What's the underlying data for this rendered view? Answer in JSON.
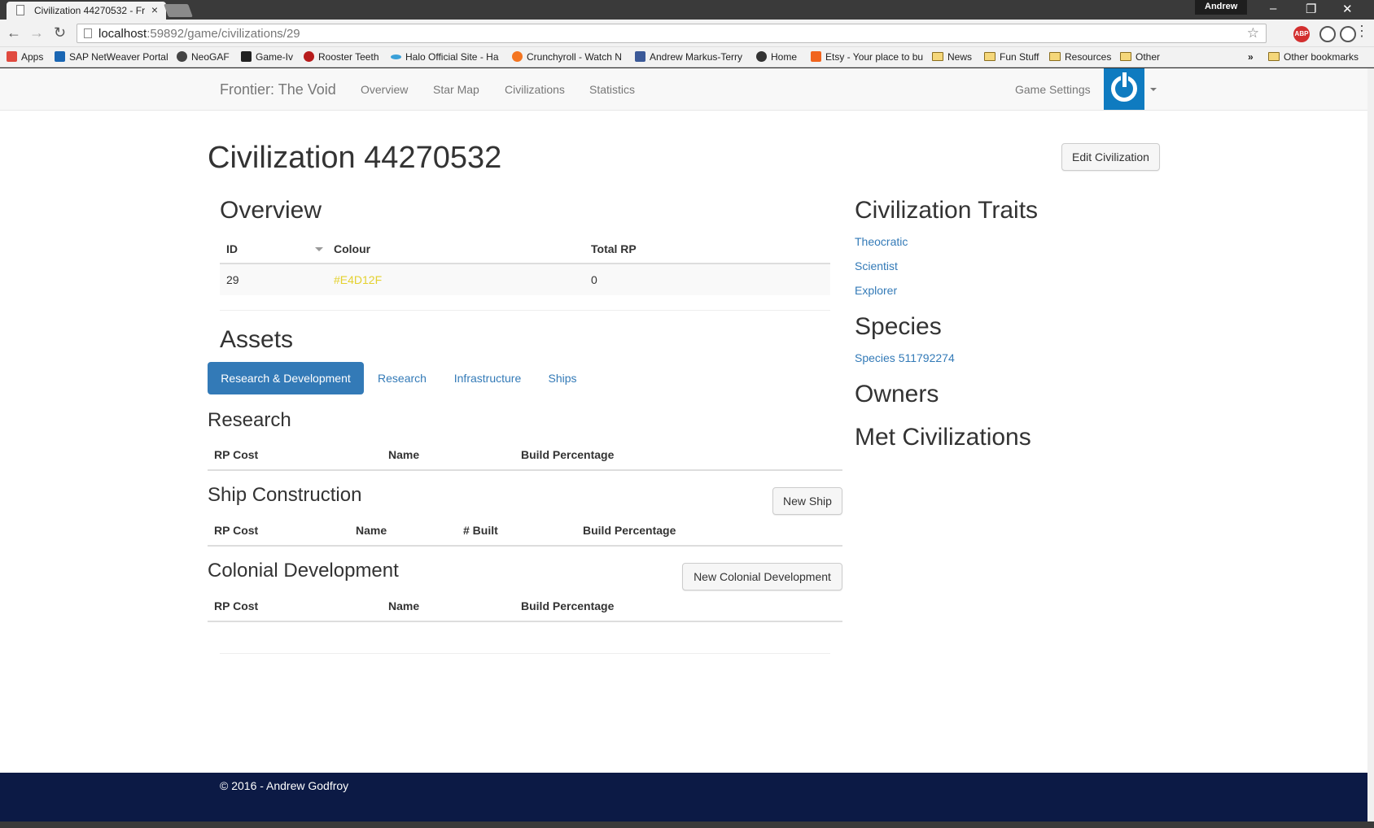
{
  "browser": {
    "tab_title": "Civilization 44270532 - Fr",
    "tab_close": "×",
    "user_badge": "Andrew",
    "url_host": "localhost",
    "url_rest": ":59892/game/civilizations/29",
    "minimize": "‒",
    "restore": "❐",
    "close": "✕",
    "ext_abp": "ABP",
    "bookmarks": [
      {
        "label": "Apps",
        "color": "#e04a3f"
      },
      {
        "label": "SAP NetWeaver Portal",
        "color": "#1a66b3"
      },
      {
        "label": "NeoGAF",
        "color": "#444444"
      },
      {
        "label": "Game-Iv",
        "color": "#222222"
      },
      {
        "label": "Rooster Teeth",
        "color": "#b71c1c"
      },
      {
        "label": "Halo Official Site - Ha",
        "color": "#3aa0d8"
      },
      {
        "label": "Crunchyroll - Watch N",
        "color": "#f47521"
      },
      {
        "label": "Andrew Markus-Terry",
        "color": "#3b5998"
      },
      {
        "label": "Home",
        "color": "#333333"
      },
      {
        "label": "Etsy - Your place to bu",
        "color": "#f1641e"
      }
    ],
    "folders": [
      "News",
      "Fun Stuff",
      "Resources",
      "Other"
    ],
    "overflow": "»",
    "other_bookmarks": "Other bookmarks"
  },
  "nav": {
    "brand": "Frontier: The Void",
    "links": [
      "Overview",
      "Star Map",
      "Civilizations",
      "Statistics"
    ],
    "game_settings": "Game Settings"
  },
  "page": {
    "title": "Civilization 44270532",
    "edit_button": "Edit Civilization"
  },
  "overview": {
    "heading": "Overview",
    "columns": [
      "ID",
      "Colour",
      "Total RP"
    ],
    "row": {
      "id": "29",
      "colour": "#E4D12F",
      "total_rp": "0"
    }
  },
  "assets": {
    "heading": "Assets",
    "tabs": [
      "Research & Development",
      "Research",
      "Infrastructure",
      "Ships"
    ],
    "active_tab": "Research & Development"
  },
  "research": {
    "heading": "Research",
    "columns": [
      "RP Cost",
      "Name",
      "Build Percentage"
    ]
  },
  "ships": {
    "heading": "Ship Construction",
    "button": "New Ship",
    "columns": [
      "RP Cost",
      "Name",
      "# Built",
      "Build Percentage"
    ]
  },
  "colonial": {
    "heading": "Colonial Development",
    "button": "New Colonial Development",
    "columns": [
      "RP Cost",
      "Name",
      "Build Percentage"
    ]
  },
  "sidebar": {
    "traits_heading": "Civilization Traits",
    "traits": [
      "Theocratic",
      "Scientist",
      "Explorer"
    ],
    "species_heading": "Species",
    "species": [
      "Species 511792274"
    ],
    "owners_heading": "Owners",
    "met_heading": "Met Civilizations"
  },
  "footer": {
    "copyright": "© 2016 - Andrew Godfroy"
  },
  "colors": {
    "primary": "#337ab7",
    "civ_colour": "#E4D12F",
    "footer_bg": "#0c1a45",
    "avatar_bg": "#0f7bc0"
  }
}
